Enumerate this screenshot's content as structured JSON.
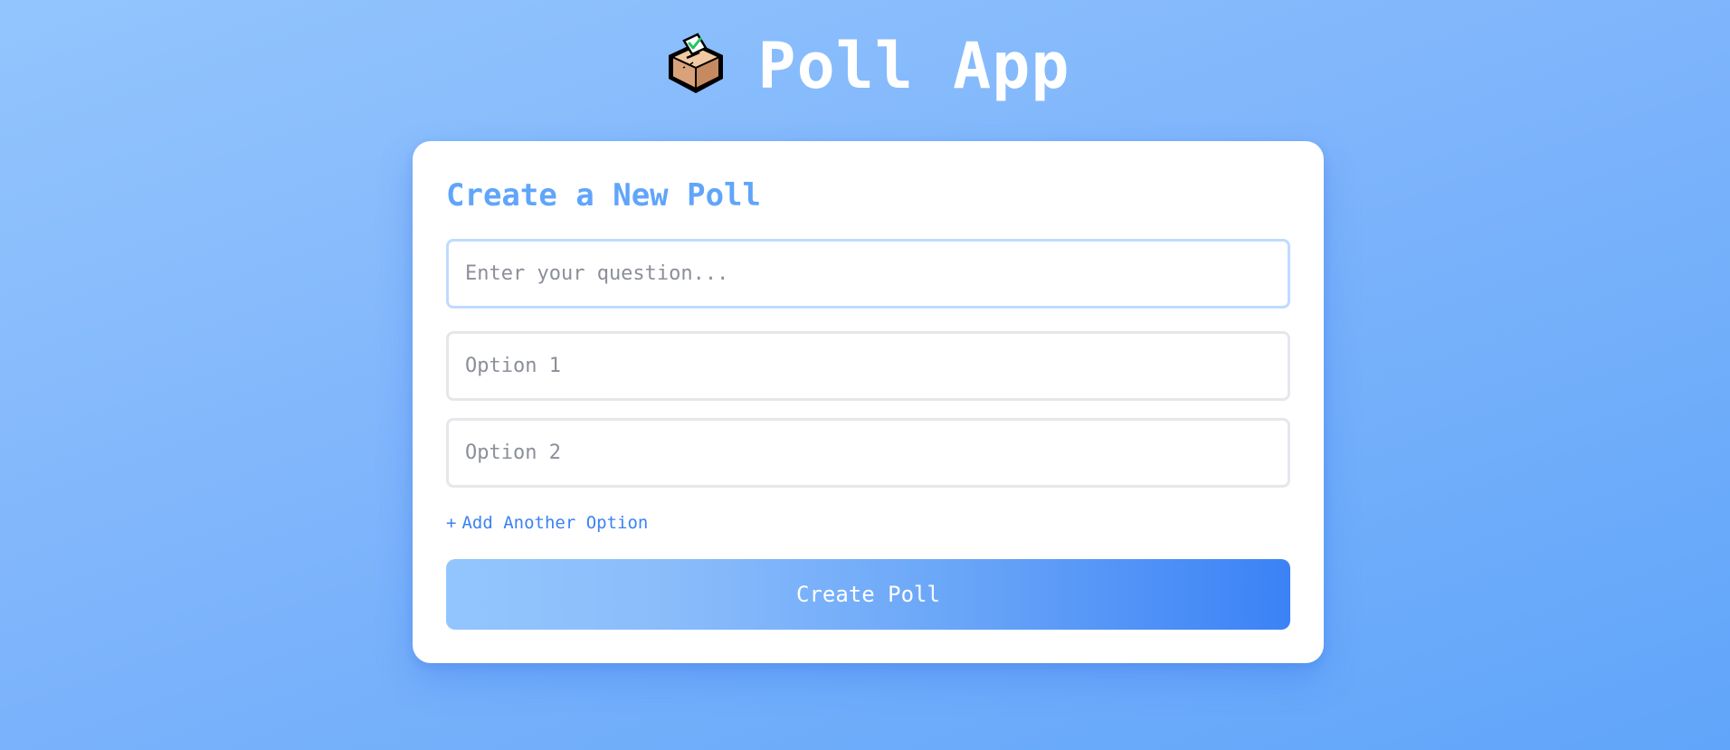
{
  "header": {
    "logo_icon": "ballot-box-icon",
    "title": "Poll App"
  },
  "form": {
    "title": "Create a New Poll",
    "question_placeholder": "Enter your question...",
    "option_placeholders": [
      "Option 1",
      "Option 2"
    ],
    "add_option_symbol": "+",
    "add_option_label": "Add Another Option",
    "submit_label": "Create Poll"
  },
  "colors": {
    "background_start": "#93c5fd",
    "background_end": "#60a5fa",
    "accent": "#3b82f6",
    "card_title": "#60a5fa",
    "button_gradient_start": "#93c5fd",
    "button_gradient_end": "#3b82f6"
  }
}
